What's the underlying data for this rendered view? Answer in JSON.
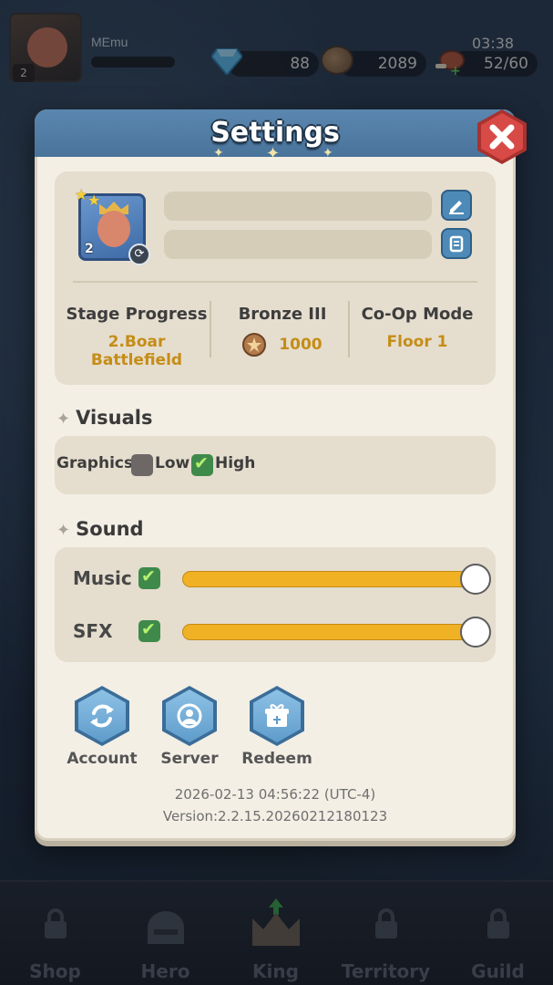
{
  "hud": {
    "player_name": "MEmu",
    "player_level": "2",
    "gems": "88",
    "gold": "2089",
    "stamina": "52/60",
    "timer": "03:38"
  },
  "modal": {
    "title": "Settings",
    "profile": {
      "avatar_level": "2",
      "stats": [
        {
          "label": "Stage Progress",
          "value": "2.Boar Battlefield"
        },
        {
          "label": "Bronze III",
          "value": "1000"
        },
        {
          "label": "Co-Op Mode",
          "value": "Floor 1"
        }
      ]
    },
    "visuals": {
      "section_title": "Visuals",
      "graphics_label": "Graphics:",
      "option_low": "Low",
      "option_high": "High",
      "selected": "High"
    },
    "sound": {
      "section_title": "Sound",
      "music_label": "Music",
      "music_enabled": true,
      "music_volume": 1.0,
      "sfx_label": "SFX",
      "sfx_enabled": true,
      "sfx_volume": 1.0
    },
    "actions": [
      {
        "label": "Account",
        "icon": "refresh-icon"
      },
      {
        "label": "Server",
        "icon": "globe-icon"
      },
      {
        "label": "Redeem",
        "icon": "gift-icon"
      }
    ],
    "footer": {
      "datetime": "2026-02-13 04:56:22 (UTC-4)",
      "version": "Version:2.2.15.20260212180123"
    }
  },
  "bottom_nav": [
    {
      "label": "Shop",
      "icon": "lock-icon"
    },
    {
      "label": "Hero",
      "icon": "helmet-icon"
    },
    {
      "label": "King",
      "icon": "crown-icon"
    },
    {
      "label": "Territory",
      "icon": "lock-icon"
    },
    {
      "label": "Guild",
      "icon": "lock-icon"
    }
  ],
  "colors": {
    "accent_gold": "#c58d17",
    "header_blue": "#4a739a",
    "slider_fill": "#f0b125",
    "close_red": "#d84a46"
  }
}
